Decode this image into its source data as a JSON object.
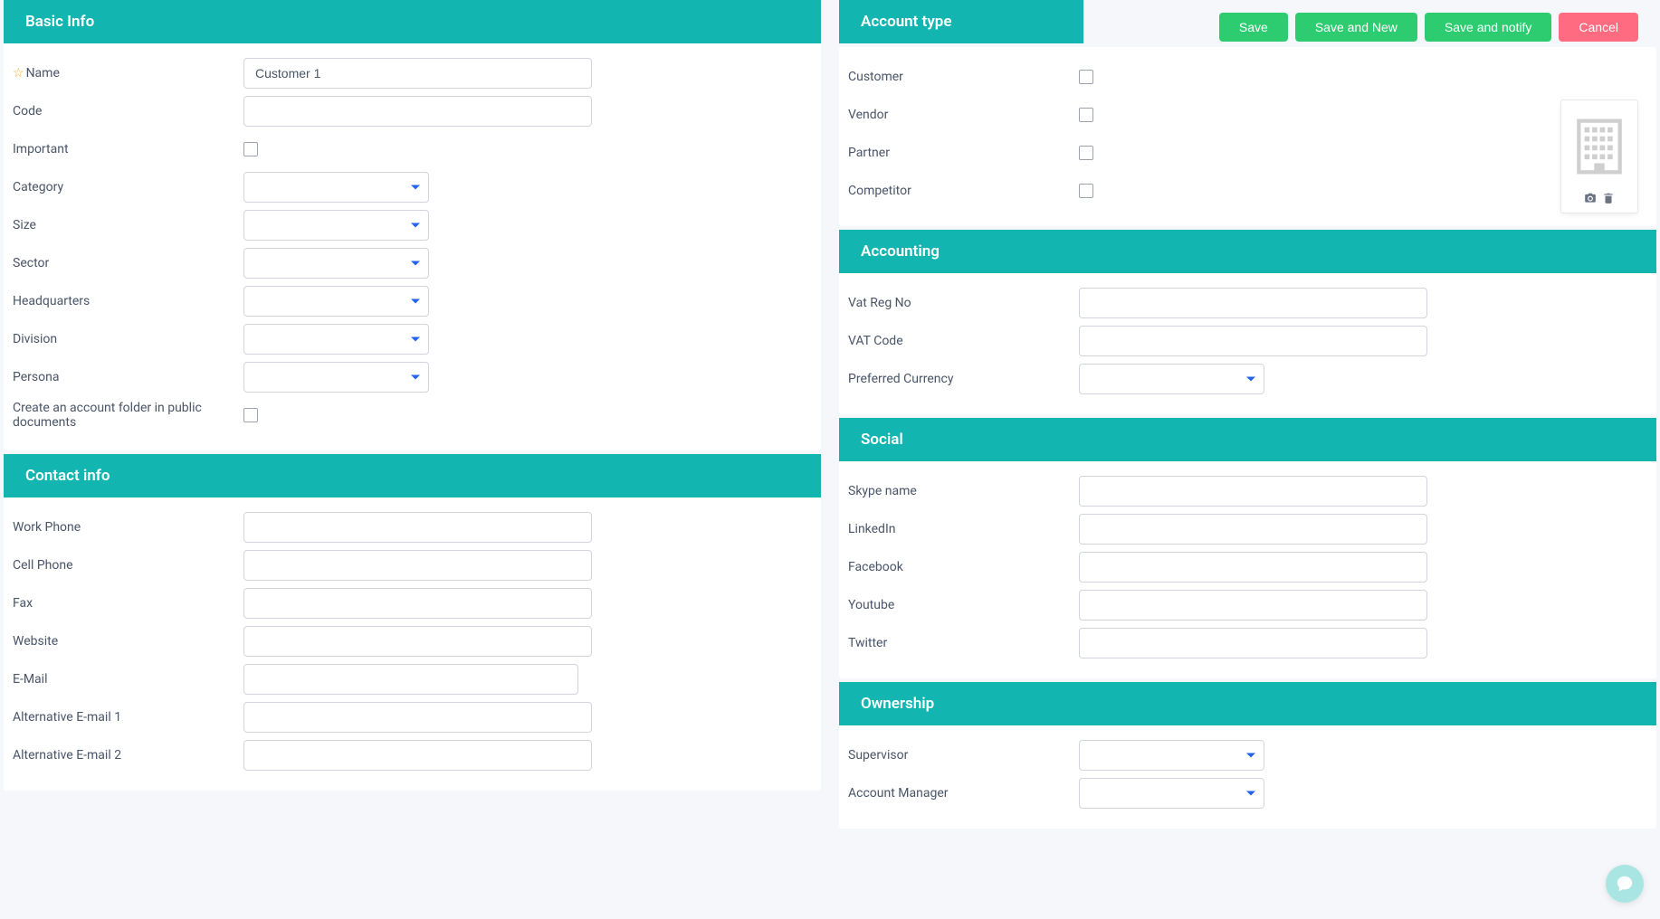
{
  "actions": {
    "save": "Save",
    "saveNew": "Save and New",
    "saveNotify": "Save and notify",
    "cancel": "Cancel"
  },
  "sections": {
    "basicInfo": {
      "title": "Basic Info",
      "fields": {
        "name": {
          "label": "Name",
          "value": "Customer 1"
        },
        "code": {
          "label": "Code",
          "value": ""
        },
        "important": {
          "label": "Important"
        },
        "category": {
          "label": "Category",
          "value": ""
        },
        "size": {
          "label": "Size",
          "value": ""
        },
        "sector": {
          "label": "Sector",
          "value": ""
        },
        "headquarters": {
          "label": "Headquarters",
          "value": ""
        },
        "division": {
          "label": "Division",
          "value": ""
        },
        "persona": {
          "label": "Persona",
          "value": ""
        },
        "createFolder": {
          "label": "Create an account folder in public documents"
        }
      }
    },
    "contactInfo": {
      "title": "Contact info",
      "fields": {
        "workPhone": {
          "label": "Work Phone",
          "value": ""
        },
        "cellPhone": {
          "label": "Cell Phone",
          "value": ""
        },
        "fax": {
          "label": "Fax",
          "value": ""
        },
        "website": {
          "label": "Website",
          "value": ""
        },
        "email": {
          "label": "E-Mail",
          "value": ""
        },
        "altEmail1": {
          "label": "Alternative E-mail 1",
          "value": ""
        },
        "altEmail2": {
          "label": "Alternative E-mail 2",
          "value": ""
        }
      }
    },
    "accountType": {
      "title": "Account type",
      "fields": {
        "customer": {
          "label": "Customer"
        },
        "vendor": {
          "label": "Vendor"
        },
        "partner": {
          "label": "Partner"
        },
        "competitor": {
          "label": "Competitor"
        }
      }
    },
    "accounting": {
      "title": "Accounting",
      "fields": {
        "vatRegNo": {
          "label": "Vat Reg No",
          "value": ""
        },
        "vatCode": {
          "label": "VAT Code",
          "value": ""
        },
        "preferredCurrency": {
          "label": "Preferred Currency",
          "value": ""
        }
      }
    },
    "social": {
      "title": "Social",
      "fields": {
        "skype": {
          "label": "Skype name",
          "value": ""
        },
        "linkedin": {
          "label": "LinkedIn",
          "value": ""
        },
        "facebook": {
          "label": "Facebook",
          "value": ""
        },
        "youtube": {
          "label": "Youtube",
          "value": ""
        },
        "twitter": {
          "label": "Twitter",
          "value": ""
        }
      }
    },
    "ownership": {
      "title": "Ownership",
      "fields": {
        "supervisor": {
          "label": "Supervisor",
          "value": ""
        },
        "accountManager": {
          "label": "Account Manager",
          "value": ""
        }
      }
    }
  }
}
